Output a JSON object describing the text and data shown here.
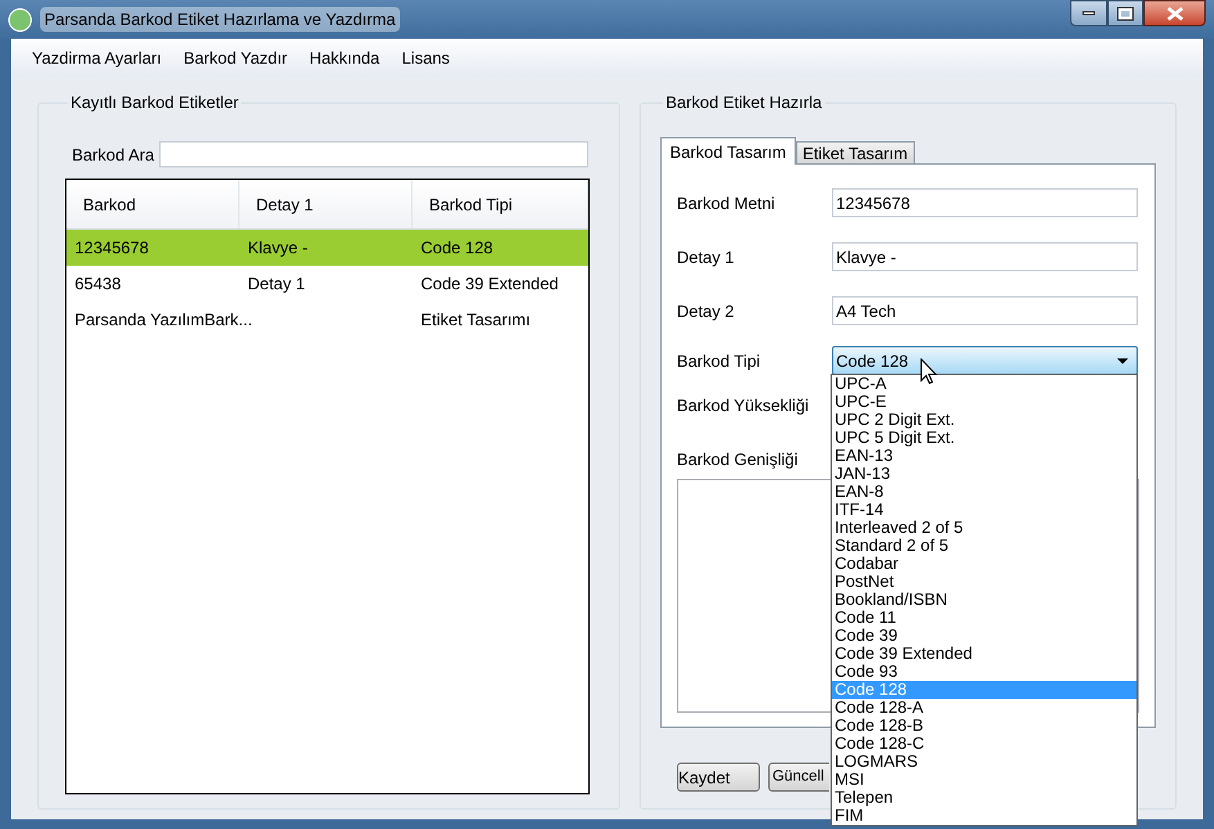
{
  "window": {
    "title": "Parsanda Barkod Etiket Hazırlama ve Yazdırma"
  },
  "menu": [
    "Yazdirma Ayarları",
    "Barkod Yazdır",
    "Hakkında",
    "Lisans"
  ],
  "saved_labels": {
    "title": "Kayıtlı Barkod Etiketler",
    "search": {
      "label": "Barkod Ara"
    },
    "table": {
      "columns": [
        "Barkod",
        "Detay 1",
        "Barkod Tipi"
      ],
      "rows": [
        {
          "cells": [
            "12345678",
            "Klavye -",
            "Code 128"
          ],
          "selected": true
        },
        {
          "cells": [
            "65438",
            "Detay 1",
            "Code 39 Extended"
          ],
          "selected": false
        },
        {
          "cells": [
            "Parsanda YazılımBark...",
            "",
            "Etiket Tasarımı"
          ],
          "selected": false
        }
      ]
    }
  },
  "prepare": {
    "title": "Barkod Etiket Hazırla",
    "tabs": [
      {
        "label": "Barkod Tasarım",
        "selected": true
      },
      {
        "label": "Etiket Tasarım",
        "selected": false
      }
    ],
    "fields": [
      {
        "label": "Barkod Metni",
        "value": "12345678"
      },
      {
        "label": "Detay 1",
        "value": "Klavye -"
      },
      {
        "label": "Detay 2",
        "value": "A4 Tech"
      }
    ],
    "barcode_type": {
      "label": "Barkod Tipi",
      "value": "Code 128",
      "expanded": true,
      "options": [
        {
          "label": "UPC-A",
          "selected": false
        },
        {
          "label": "UPC-E",
          "selected": false
        },
        {
          "label": "UPC 2 Digit Ext.",
          "selected": false
        },
        {
          "label": "UPC 5 Digit Ext.",
          "selected": false
        },
        {
          "label": "EAN-13",
          "selected": false
        },
        {
          "label": "JAN-13",
          "selected": false
        },
        {
          "label": "EAN-8",
          "selected": false
        },
        {
          "label": "ITF-14",
          "selected": false
        },
        {
          "label": "Interleaved 2 of 5",
          "selected": false
        },
        {
          "label": "Standard 2 of 5",
          "selected": false
        },
        {
          "label": "Codabar",
          "selected": false
        },
        {
          "label": "PostNet",
          "selected": false
        },
        {
          "label": "Bookland/ISBN",
          "selected": false
        },
        {
          "label": "Code 11",
          "selected": false
        },
        {
          "label": "Code 39",
          "selected": false
        },
        {
          "label": "Code 39 Extended",
          "selected": false
        },
        {
          "label": "Code 93",
          "selected": false
        },
        {
          "label": "Code 128",
          "selected": true
        },
        {
          "label": "Code 128-A",
          "selected": false
        },
        {
          "label": "Code 128-B",
          "selected": false
        },
        {
          "label": "Code 128-C",
          "selected": false
        },
        {
          "label": "LOGMARS",
          "selected": false
        },
        {
          "label": "MSI",
          "selected": false
        },
        {
          "label": "Telepen",
          "selected": false
        },
        {
          "label": "FIM",
          "selected": false
        }
      ]
    },
    "other_labels": [
      "Barkod Yüksekliği",
      "Barkod Genişliği"
    ],
    "buttons": [
      "Kaydet",
      "Güncell"
    ]
  }
}
